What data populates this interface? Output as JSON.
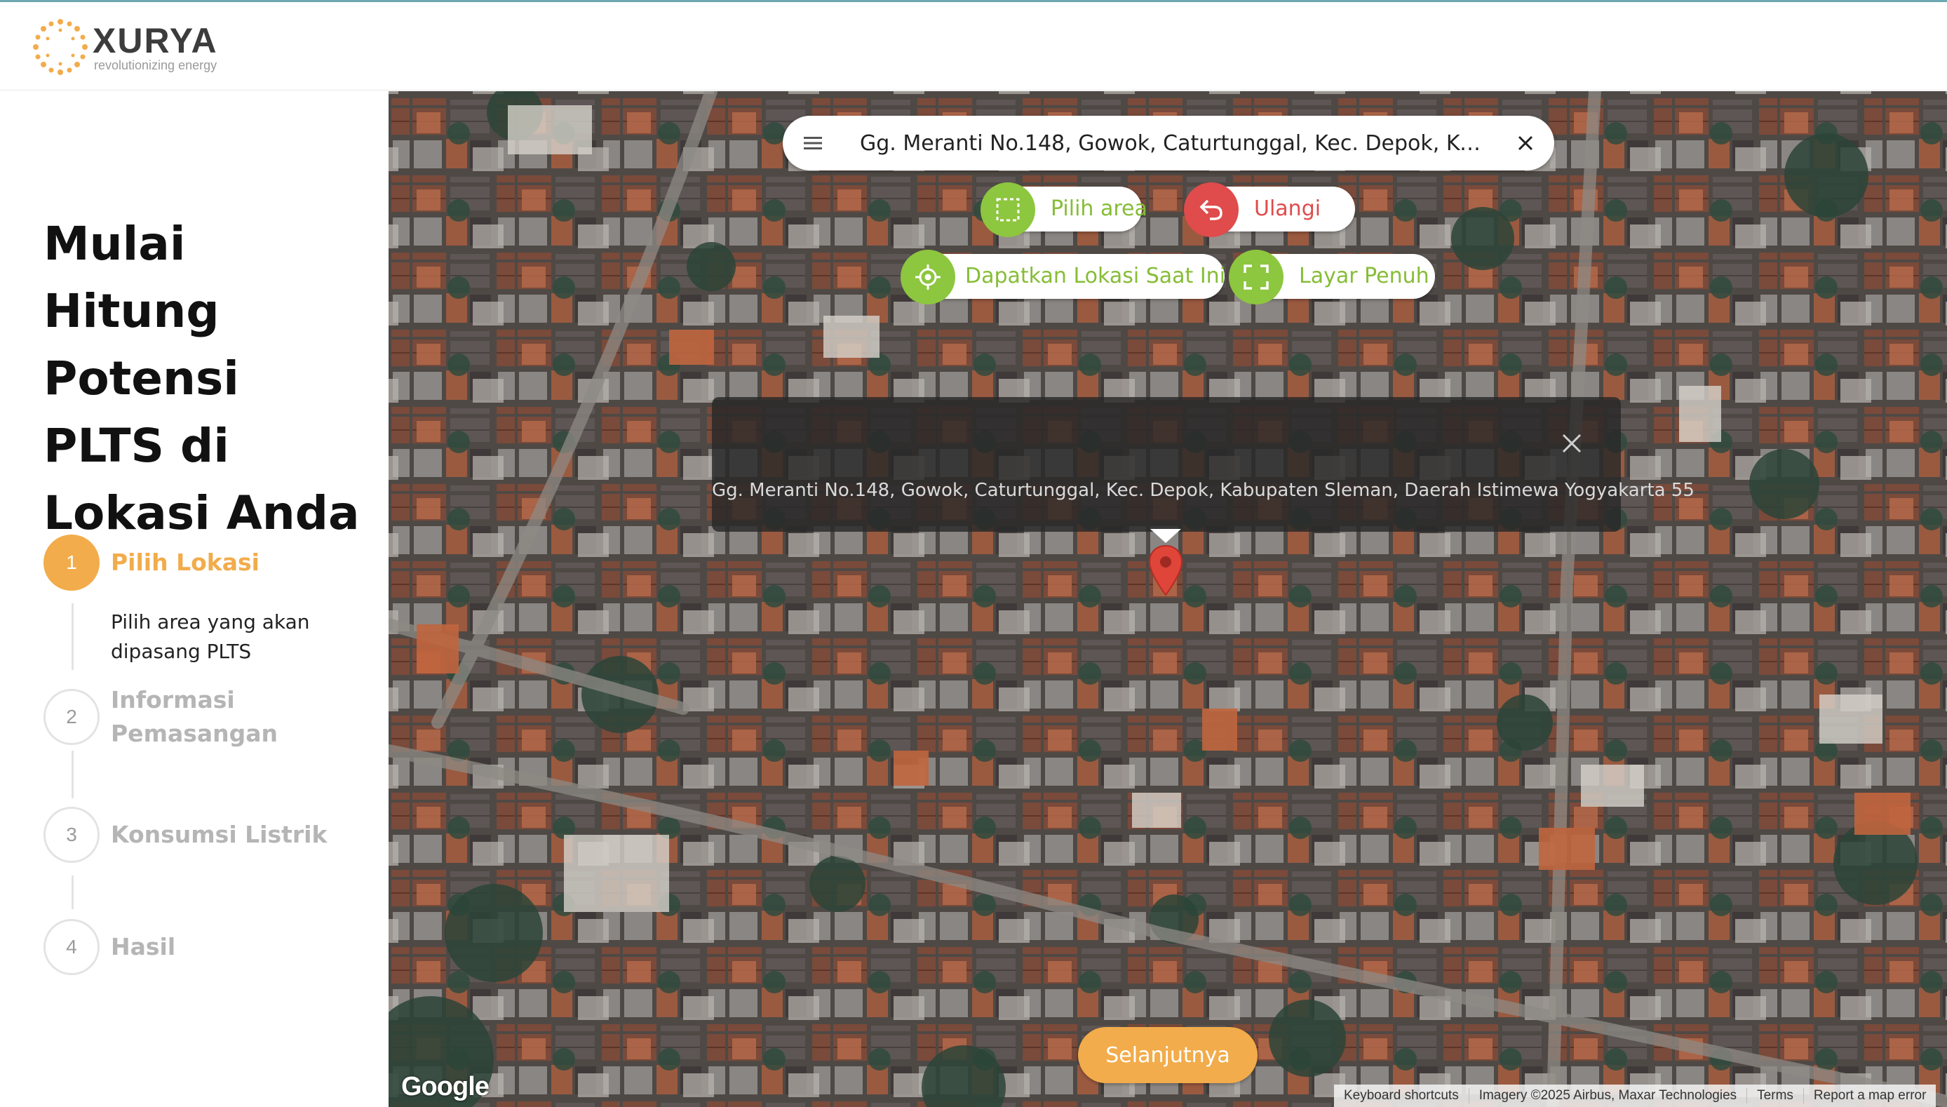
{
  "brand": {
    "name": "XURYA",
    "tagline": "revolutionizing energy",
    "accent": "#f2ac4b"
  },
  "sidebar": {
    "title": "Mulai Hitung Potensi PLTS di Lokasi Anda",
    "steps": [
      {
        "number": "1",
        "label": "Pilih Lokasi",
        "desc": "Pilih area yang akan dipasang PLTS",
        "active": true
      },
      {
        "number": "2",
        "label": "Informasi Pemasangan",
        "active": false
      },
      {
        "number": "3",
        "label": "Konsumsi Listrik",
        "active": false
      },
      {
        "number": "4",
        "label": "Hasil",
        "active": false
      }
    ]
  },
  "map": {
    "search_value": "Gg. Meranti No.148, Gowok, Caturtunggal, Kec. Depok, Kabupaten...",
    "buttons": {
      "select_area": "Pilih area",
      "reset": "Ulangi",
      "current_location": "Dapatkan Lokasi Saat Ini",
      "fullscreen": "Layar Penuh"
    },
    "info_window_address": "Gg. Meranti No.148, Gowok, Caturtunggal, Kec. Depok, Kabupaten Sleman, Daerah Istimewa Yogyakarta 55",
    "next_button": "Selanjutnya",
    "google_logo": "Google",
    "attribution": {
      "shortcuts": "Keyboard shortcuts",
      "imagery": "Imagery ©2025 Airbus, Maxar Technologies",
      "terms": "Terms",
      "report": "Report a map error"
    },
    "colors": {
      "green": "#8dc63f",
      "red": "#e04b4b"
    }
  }
}
